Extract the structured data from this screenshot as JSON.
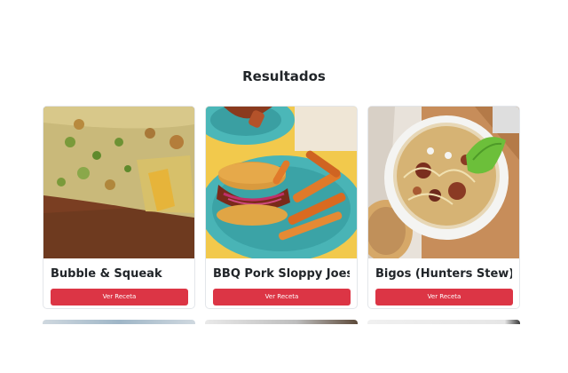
{
  "page": {
    "title": "Resultados"
  },
  "button_color": "#dc3545",
  "recipes": [
    {
      "name": "Bubble & Squeak",
      "button_label": "Ver Receta",
      "image": "bubble-and-squeak-photo"
    },
    {
      "name": "BBQ Pork Sloppy Joes",
      "button_label": "Ver Receta",
      "image": "bbq-pork-sloppy-joes-photo"
    },
    {
      "name": "Bigos (Hunters Stew)",
      "button_label": "Ver Receta",
      "image": "bigos-hunters-stew-photo"
    }
  ]
}
